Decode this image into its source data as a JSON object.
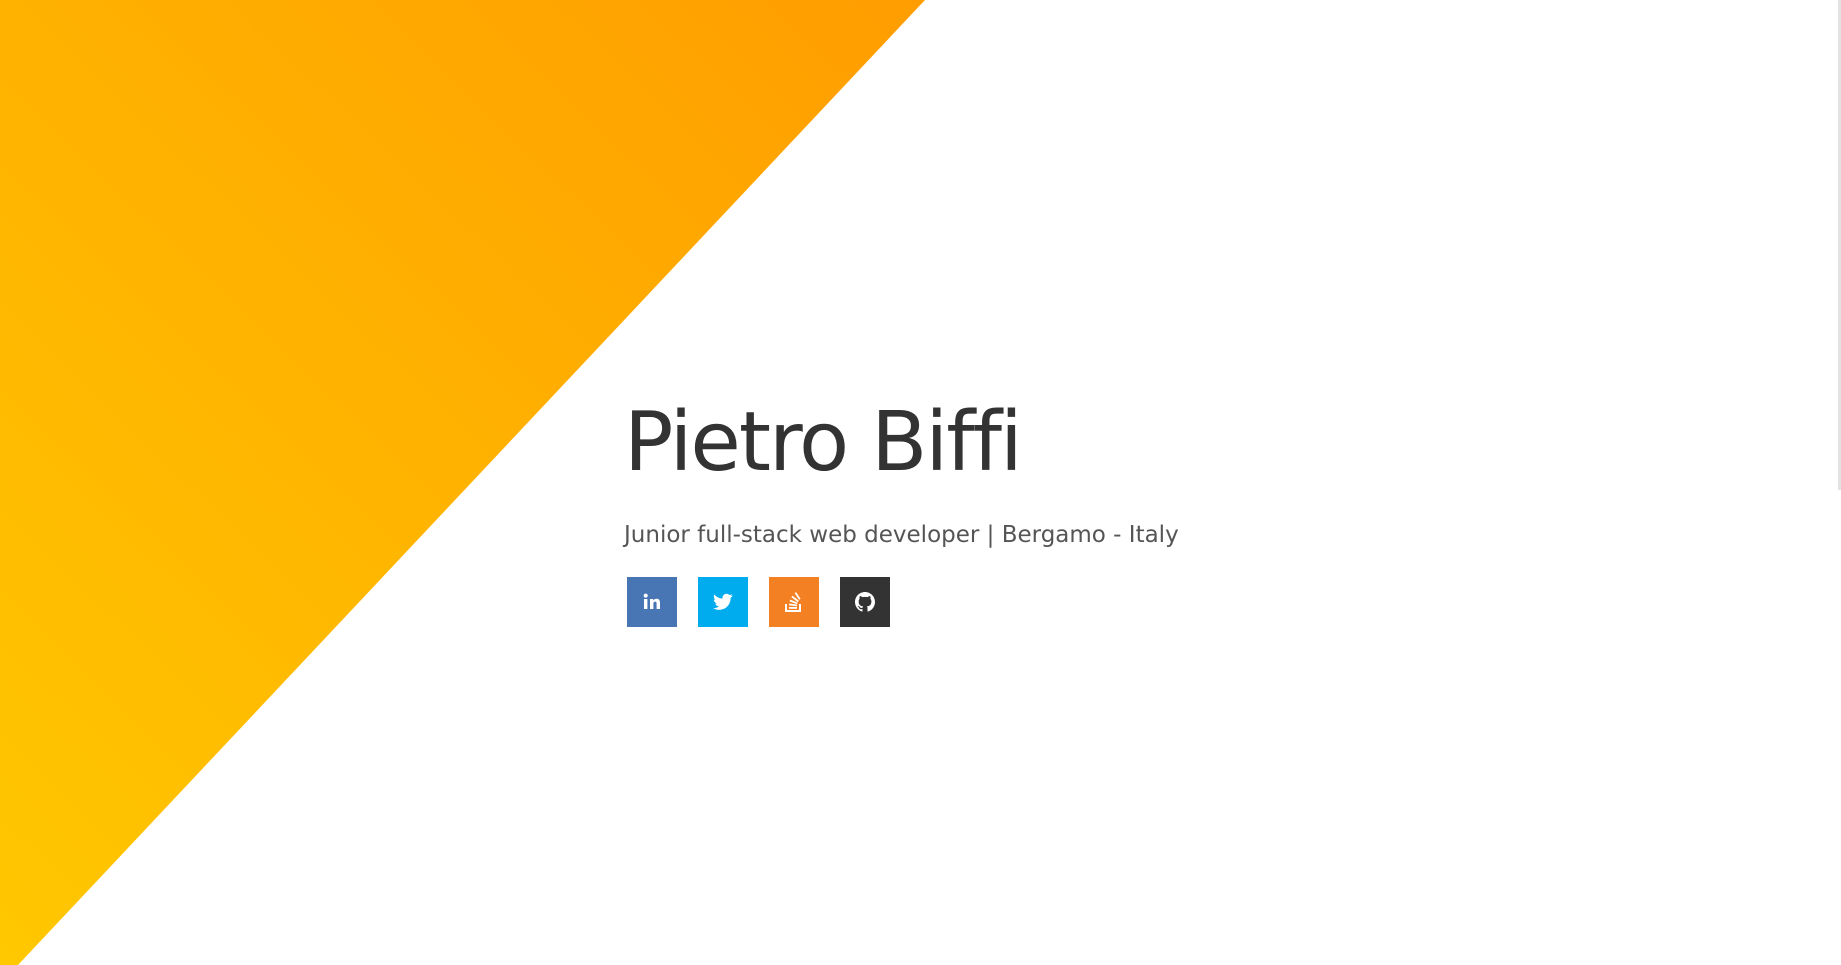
{
  "hero": {
    "name": "Pietro Biffi",
    "tagline": "Junior full-stack web developer | Bergamo - Italy",
    "gradient": {
      "from": "#ffc800",
      "to": "#ff9d00"
    }
  },
  "social": [
    {
      "network": "LinkedIn",
      "icon": "linkedin-icon",
      "color": "#4875b4"
    },
    {
      "network": "Twitter",
      "icon": "twitter-icon",
      "color": "#00aced"
    },
    {
      "network": "Stack Overflow",
      "icon": "stackoverflow-icon",
      "color": "#f48024"
    },
    {
      "network": "GitHub",
      "icon": "github-icon",
      "color": "#333333"
    }
  ]
}
